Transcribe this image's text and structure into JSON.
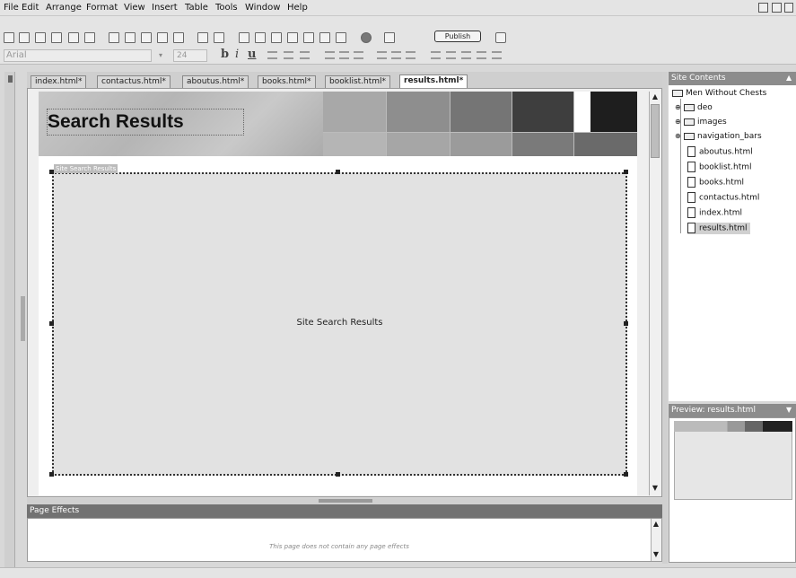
{
  "menu": {
    "items": [
      "File",
      "Edit",
      "Arrange",
      "Format",
      "View",
      "Insert",
      "Table",
      "Tools",
      "Window",
      "Help"
    ]
  },
  "toolbar": {
    "publish_label": "Publish",
    "font_name": "Arial",
    "font_size": "24",
    "bold_label": "b",
    "italic_label": "i",
    "underline_label": "u"
  },
  "tabs": [
    {
      "label": "index.html*"
    },
    {
      "label": "contactus.html*"
    },
    {
      "label": "aboutus.html*"
    },
    {
      "label": "books.html*"
    },
    {
      "label": "booklist.html*"
    },
    {
      "label": "results.html*"
    }
  ],
  "page": {
    "header_title": "Search Results",
    "search_region_label": "Site Search Results",
    "search_region_caption": "Site Search Results"
  },
  "page_effects": {
    "title": "Page Effects",
    "message": "This page does not contain any page effects"
  },
  "site_contents": {
    "title": "Site Contents",
    "root": "Men Without Chests",
    "folders": [
      "deo",
      "images",
      "navigation_bars"
    ],
    "files": [
      "aboutus.html",
      "booklist.html",
      "books.html",
      "contactus.html",
      "index.html",
      "results.html"
    ],
    "selected": "results.html"
  },
  "preview": {
    "title": "Preview: results.html"
  },
  "colors": {
    "panel_header": "#8c8c8c",
    "effects_header": "#727272",
    "selected_file_bg": "#d0d0d0"
  }
}
